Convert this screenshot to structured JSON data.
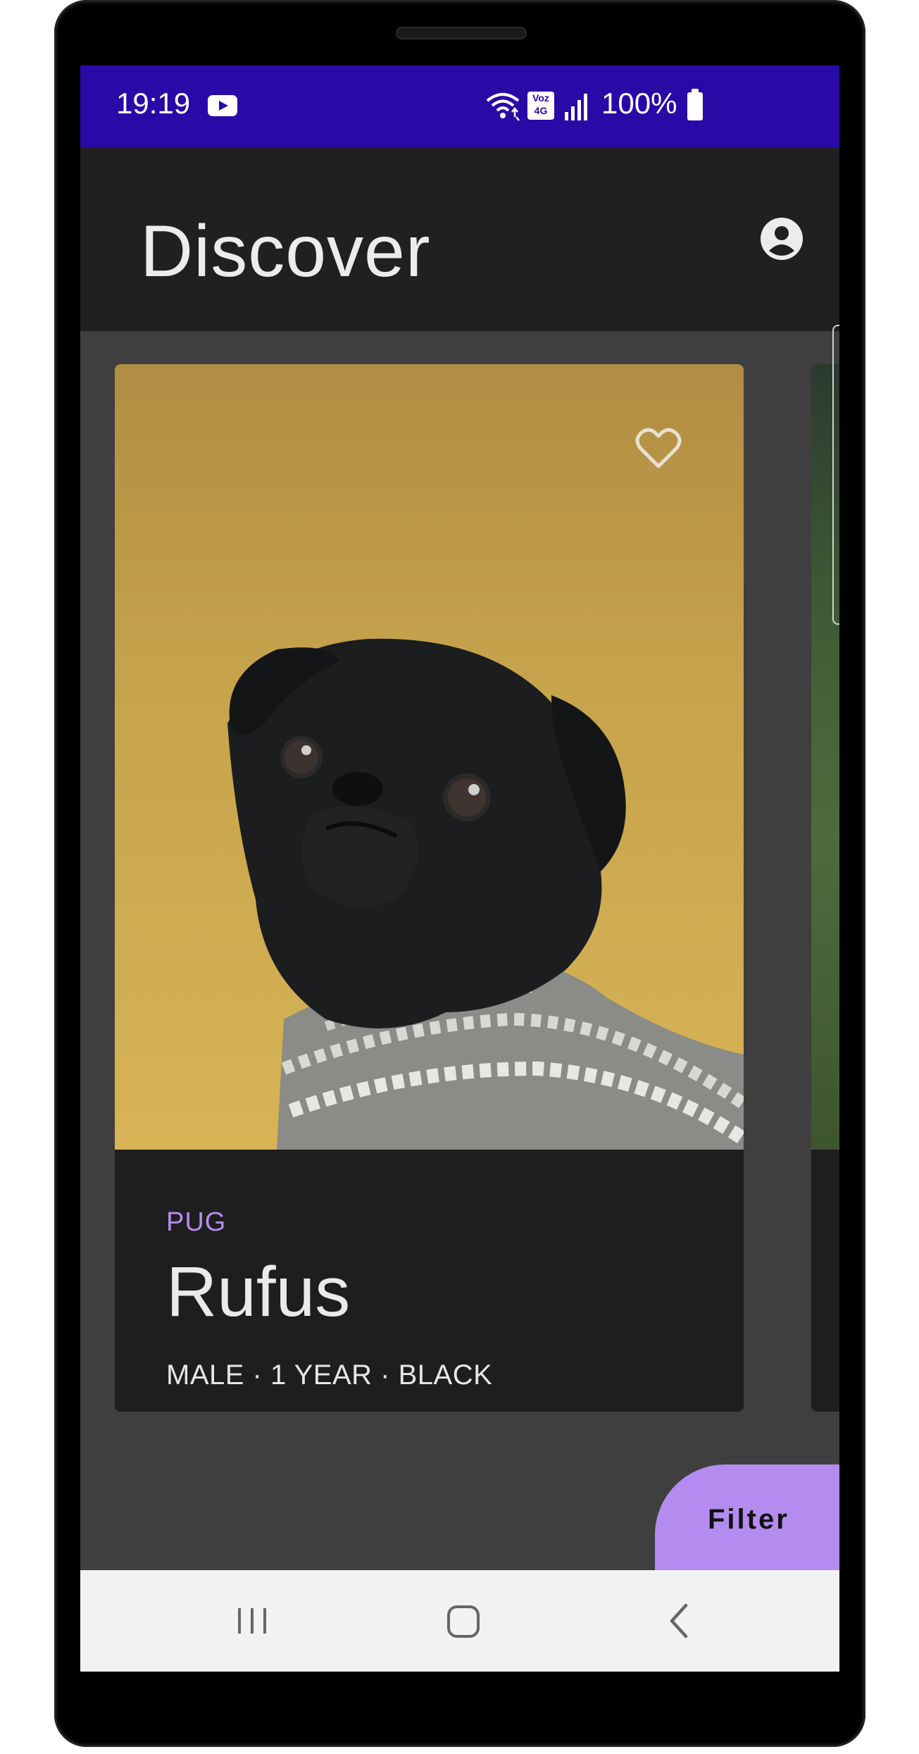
{
  "status_bar": {
    "time": "19:19",
    "battery": "100%",
    "network_badge_line1": "Voz",
    "network_badge_line2": "4G",
    "icons": [
      "youtube-icon",
      "wifi-icon",
      "volte-icon",
      "signal-icon",
      "battery-icon"
    ]
  },
  "app_bar": {
    "title": "Discover",
    "account_icon": "account-circle-icon"
  },
  "cards": [
    {
      "breed": "PUG",
      "name": "Rufus",
      "details": "MALE · 1 YEAR · BLACK",
      "favorite_icon": "heart-outline-icon",
      "image": "black pug in knitted sweater on yellow background"
    }
  ],
  "fab": {
    "label": "Filter"
  },
  "nav_bar": {
    "icons": [
      "recents-icon",
      "home-icon",
      "back-icon"
    ]
  },
  "colors": {
    "status_bar": "#2a0aa6",
    "app_bar": "#202020",
    "background": "#3f3f3f",
    "card": "#1e1e1e",
    "accent": "#b48cf0",
    "nav_bar": "#f2f2f2"
  }
}
